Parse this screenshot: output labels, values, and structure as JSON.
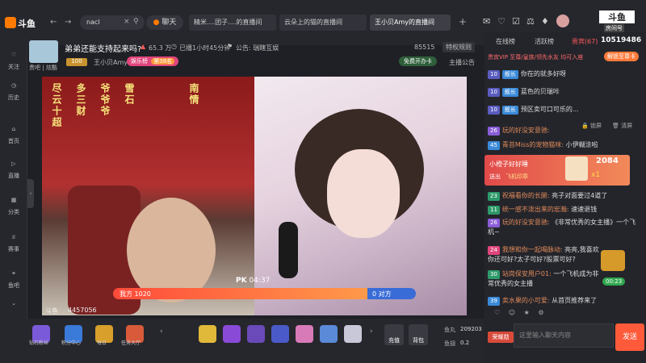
{
  "app": {
    "logo": "斗鱼"
  },
  "browser": {
    "address": "nacl",
    "chat_btn": "聊天",
    "tabs": [
      "精米....团子....的直播间",
      "云朵上的猫的直播间",
      "王小贝Amy的直播间"
    ],
    "top_right_label": "房间号",
    "room_number": "10519486"
  },
  "stream": {
    "title": "弟弟还能支持起来吗?",
    "heat": "65.3 万",
    "duration": "已播1小时45分钟",
    "notice": "公告: 瑞瞎互娱",
    "streamer": "王小贝Amy",
    "category_tag": "娱乐榜",
    "rank_tag": "第38名",
    "room_id_label": "85515",
    "report": "特权规则",
    "free_card": "免费开办卡",
    "host_notice": "主播公告",
    "level": "贵吧 | 炫酷"
  },
  "leftnav": [
    {
      "label": "关注",
      "icon": "heart-icon"
    },
    {
      "label": "历史",
      "icon": "history-icon"
    },
    {
      "label": "首页",
      "icon": "home-icon"
    },
    {
      "label": "直播",
      "icon": "live-icon"
    },
    {
      "label": "分类",
      "icon": "category-icon"
    },
    {
      "label": "赛事",
      "icon": "trophy-icon"
    },
    {
      "label": "鱼吧",
      "icon": "fish-icon"
    }
  ],
  "pk": {
    "label": "PK",
    "time": "04:37",
    "our_side": "我方 1020",
    "their_side": "0 对方",
    "bottom_name": "斗鱼",
    "viewer_count": "4457056"
  },
  "right_tabs": {
    "online": "在线榜",
    "events": "活跃榜",
    "vip": "贵宾(67)"
  },
  "top_notice": {
    "text": "贵宾VIP 至尊/皇族/领先水友 均可入座",
    "btn": "解锁至尊卡"
  },
  "vip_list": [
    {
      "level": "10",
      "name": "舰长",
      "text": "你在的就多好呀"
    },
    {
      "level": "10",
      "name": "舰长",
      "text": "蓝色的贝瑞咔"
    },
    {
      "level": "10",
      "name": "舰长",
      "text": "预区卖可口可乐的..."
    }
  ],
  "chat_tools": {
    "lock": "锁屏",
    "clear": "清屏"
  },
  "chat": [
    {
      "lv": "26",
      "name": "玩的好没安意驰:",
      "text": ""
    },
    {
      "lv": "45",
      "name": "青苔Miss的宠物猫咪:",
      "text": "小伊糊涂啦"
    },
    {
      "lv": "23",
      "name": "祝福看你的长腿:",
      "text": "亮子对面要过4道了"
    },
    {
      "lv": "11",
      "name": "统一感不泼出来的宏瀚:",
      "text": "速速退钱"
    },
    {
      "lv": "26",
      "name": "玩的好没安意驰:",
      "text": "《非常优秀的女主播》一个飞机~"
    },
    {
      "lv": "24",
      "name": "我想和你一起喝脉动:",
      "text": "亮亮,我喜欢你还可好?太子可好?股票可好?"
    },
    {
      "lv": "30",
      "name": "站岗保安用户01:",
      "text": "一个飞机成为非常优秀的女主播"
    },
    {
      "lv": "39",
      "name": "卖水果的小可爱:",
      "text": "从首页推荐来了"
    }
  ],
  "gift_banner": {
    "name": "小橙子好好睡",
    "action": "送出",
    "gift": "飞机印章",
    "count": "2084",
    "mult": "x1"
  },
  "treasure_time": "00:23",
  "bottom": {
    "recharge": "充值",
    "backpack": "背包",
    "fish_ball_label": "鱼丸",
    "fish_ball": "209203",
    "fish_coin_label": "鱼翅",
    "fish_coin": "0.2",
    "fan_label": "荣耀勋",
    "gifts_left": [
      "钻石粉丝",
      "积分中心",
      "每日",
      "任务大厅"
    ],
    "input_placeholder": "这里输入聊天内容",
    "send": "发送"
  }
}
